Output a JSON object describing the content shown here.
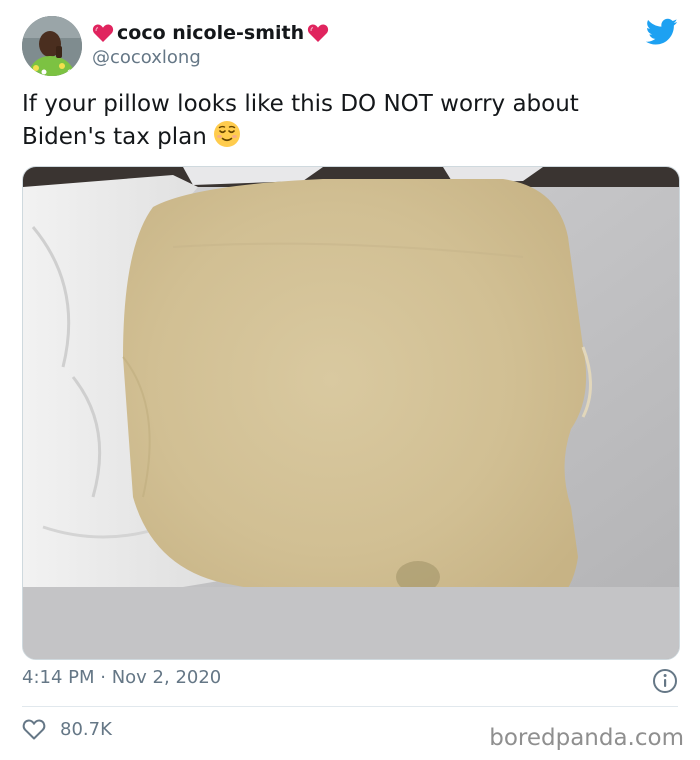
{
  "author": {
    "display_name": "coco nicole-smith",
    "handle": "@cocoxlong",
    "name_emoji": "heart-icon"
  },
  "tweet": {
    "text": "If your pillow looks like this DO NOT worry about Biden's tax plan",
    "emoji": "relieved-face-emoji",
    "time": "4:14 PM",
    "separator": " · ",
    "date": "Nov 2, 2020"
  },
  "engagement": {
    "likes": "80.7K"
  },
  "watermark": "boredpanda.com",
  "colors": {
    "twitter_blue": "#1da1f2",
    "heart_pink": "#e0245e",
    "secondary_text": "#657786",
    "primary_text": "#14171a"
  }
}
